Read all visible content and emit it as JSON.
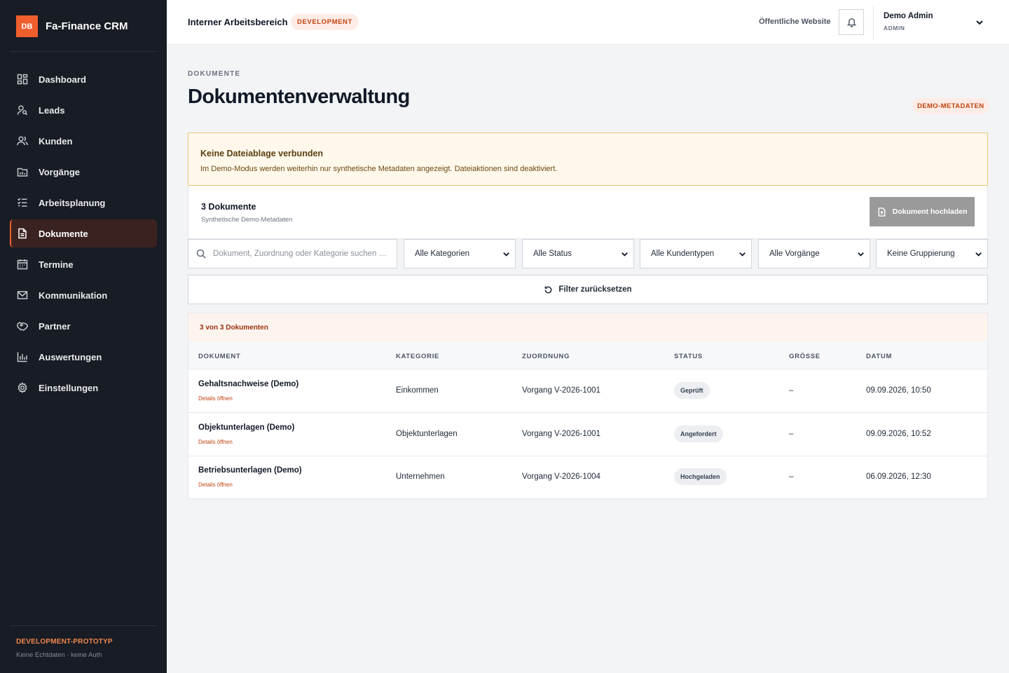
{
  "brand": {
    "logo_text": "DB",
    "name": "Fa-Finance CRM"
  },
  "sidebar": {
    "items": [
      {
        "label": "Dashboard",
        "icon": "dashboard-icon",
        "active": false
      },
      {
        "label": "Leads",
        "icon": "user-search-icon",
        "active": false
      },
      {
        "label": "Kunden",
        "icon": "users-icon",
        "active": false
      },
      {
        "label": "Vorgänge",
        "icon": "chart-folder-icon",
        "active": false
      },
      {
        "label": "Arbeitsplanung",
        "icon": "checklist-icon",
        "active": false
      },
      {
        "label": "Dokumente",
        "icon": "document-icon",
        "active": true
      },
      {
        "label": "Termine",
        "icon": "calendar-icon",
        "active": false
      },
      {
        "label": "Kommunikation",
        "icon": "mail-icon",
        "active": false
      },
      {
        "label": "Partner",
        "icon": "handshake-icon",
        "active": false
      },
      {
        "label": "Auswertungen",
        "icon": "bar-chart-icon",
        "active": false
      },
      {
        "label": "Einstellungen",
        "icon": "gear-icon",
        "active": false
      }
    ],
    "footer_title": "DEVELOPMENT-PROTOTYP",
    "footer_sub": "Keine Echtdaten · keine Auth"
  },
  "header": {
    "workspace": "Interner Arbeitsbereich",
    "env_badge": "DEVELOPMENT",
    "public_link": "Öffentliche Website",
    "user_name": "Demo Admin",
    "user_role": "ADMIN"
  },
  "page": {
    "eyebrow": "DOKUMENTE",
    "title": "Dokumentenverwaltung",
    "meta_badge": "DEMO-METADATEN"
  },
  "alert": {
    "title": "Keine Dateiablage verbunden",
    "text": "Im Demo-Modus werden weiterhin nur synthetische Metadaten angezeigt. Dateiaktionen sind deaktiviert."
  },
  "documents": {
    "count_label": "3 Dokumente",
    "sub_label": "Synthetische Demo-Metadaten",
    "upload_label": "Dokument hochladen"
  },
  "filters": {
    "search_placeholder": "Dokument, Zuordnung oder Kategorie suchen …",
    "category": "Alle Kategorien",
    "status": "Alle Status",
    "customer_type": "Alle Kundentypen",
    "process": "Alle Vorgänge",
    "grouping": "Keine Gruppierung",
    "reset_label": "Filter zurücksetzen"
  },
  "table": {
    "info": "3 von 3 Dokumenten",
    "columns": [
      "DOKUMENT",
      "KATEGORIE",
      "ZUORDNUNG",
      "STATUS",
      "GRÖSSE",
      "DATUM"
    ],
    "rows": [
      {
        "name": "Gehaltsnachweise (Demo)",
        "link": "Details öffnen",
        "category": "Einkommen",
        "assignment": "Vorgang V-2026-1001",
        "status": "Geprüft",
        "size": "–",
        "date": "09.09.2026, 10:50"
      },
      {
        "name": "Objektunterlagen (Demo)",
        "link": "Details öffnen",
        "category": "Objektunterlagen",
        "assignment": "Vorgang V-2026-1001",
        "status": "Angefordert",
        "size": "–",
        "date": "09.09.2026, 10:52"
      },
      {
        "name": "Betriebsunterlagen (Demo)",
        "link": "Details öffnen",
        "category": "Unternehmen",
        "assignment": "Vorgang V-2026-1004",
        "status": "Hochgeladen",
        "size": "–",
        "date": "06.09.2026, 12:30"
      }
    ]
  }
}
